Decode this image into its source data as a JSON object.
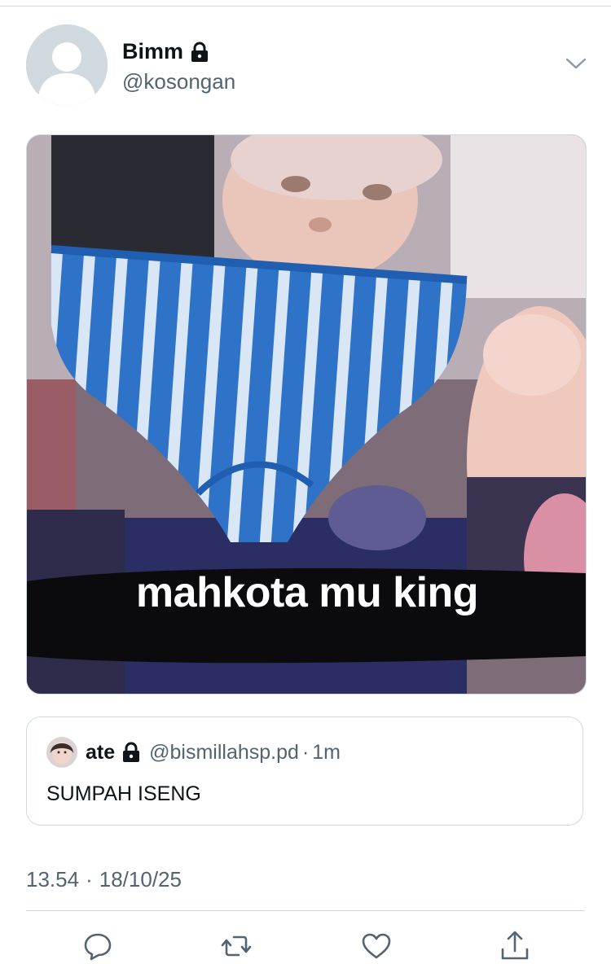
{
  "tweet": {
    "author_name": "Bimm",
    "author_handle": "@kosongan",
    "author_locked_icon": "lock-icon",
    "menu_icon": "chevron-down-icon",
    "media": {
      "caption": "mahkota mu king"
    },
    "quote": {
      "name": "ate",
      "locked_icon": "lock-icon",
      "handle": "@bismillahsp.pd",
      "separator": "·",
      "time": "1m",
      "text": "SUMPAH ISENG"
    },
    "time": "13.54",
    "separator": "·",
    "date": "18/10/25"
  },
  "actions": {
    "icons": [
      "reply-icon",
      "retweet-icon",
      "like-icon",
      "share-icon"
    ]
  },
  "colors": {
    "text": "#0f1419",
    "muted": "#536471",
    "border": "#cfd9de"
  }
}
